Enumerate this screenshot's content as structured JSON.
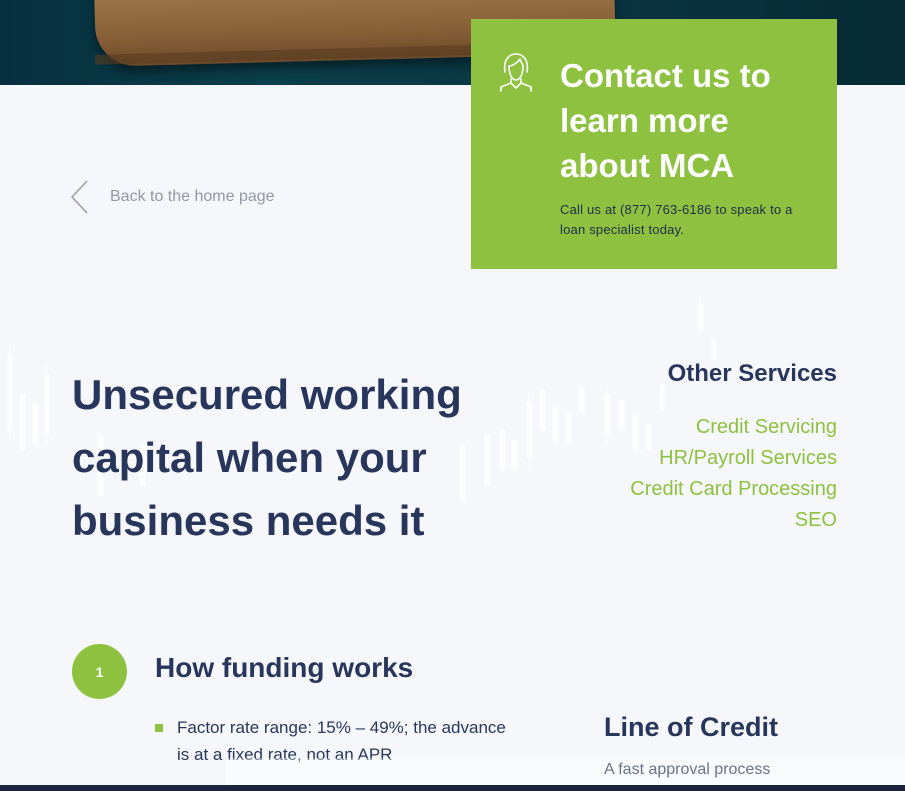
{
  "contact": {
    "title": "Contact us to learn more about MCA",
    "text": "Call us at (877) 763-6186 to speak to a loan specialist today.",
    "icon": "agent-icon"
  },
  "back_link": {
    "label": "Back to the home page",
    "icon": "chevron-left-icon"
  },
  "main": {
    "title": "Unsecured working capital when your business needs it"
  },
  "other_services": {
    "heading": "Other Services",
    "items": [
      "Credit Servicing",
      "HR/Payroll Services",
      "Credit Card Processing",
      "SEO"
    ]
  },
  "step": {
    "number": "1",
    "title": "How funding works",
    "bullet": "Factor rate range: 15% – 49%; the advance is at a fixed rate, not an APR"
  },
  "line_of_credit": {
    "title": "Line of Credit",
    "desc": "A fast approval process"
  },
  "colors": {
    "accent": "#8dc13f",
    "navy": "#27365a",
    "background": "#f6f7fb"
  }
}
